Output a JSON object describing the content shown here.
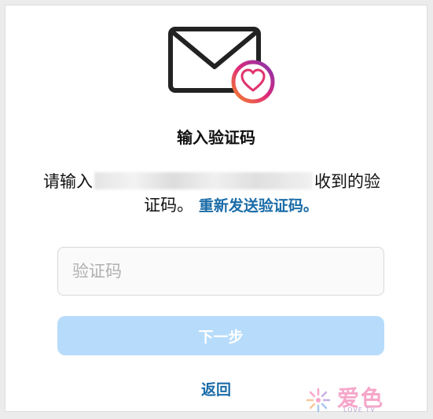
{
  "dialog": {
    "title": "输入验证码",
    "description_prefix": "请输入",
    "description_suffix": "收到的验",
    "description_line2": "证码。",
    "resend_link": "重新发送验证码。"
  },
  "code_input": {
    "placeholder": "验证码",
    "value": ""
  },
  "next_button": {
    "label": "下一步",
    "enabled": false
  },
  "back_link": "返回",
  "watermark": {
    "text": "爱色",
    "subtext": "LOVE TV"
  },
  "colors": {
    "link": "#1a6ca8",
    "button_disabled": "#b7dcfb",
    "badge_gradient_start": "#f58529",
    "badge_gradient_end": "#c13584"
  },
  "icons": {
    "envelope": "mail-envelope-icon",
    "badge": "heart-badge-icon"
  }
}
